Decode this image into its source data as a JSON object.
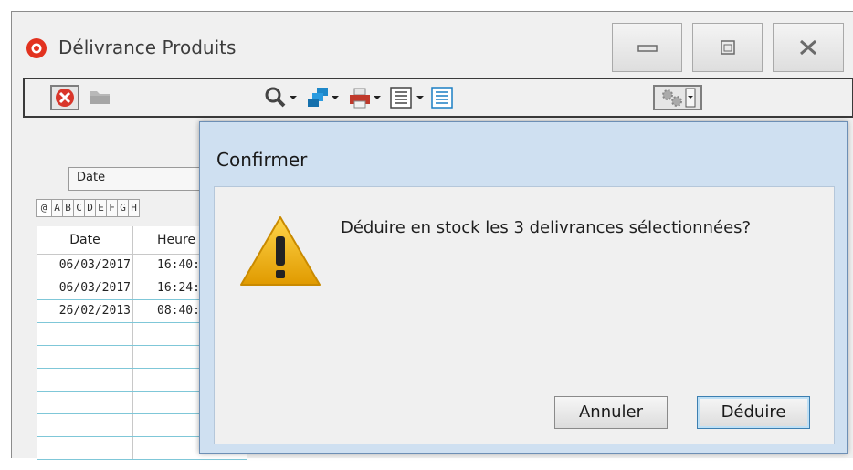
{
  "window": {
    "title": "Délivrance Produits"
  },
  "toolbar": {
    "icons": [
      "close-circle-icon",
      "folder-icon",
      "search-icon",
      "copy-icon",
      "print-icon",
      "list-icon",
      "list-icon",
      "gears-icon"
    ]
  },
  "filter": {
    "selected": "Date"
  },
  "alphabet_tabs": [
    "@",
    "A",
    "B",
    "C",
    "D",
    "E",
    "F",
    "G",
    "H"
  ],
  "table": {
    "columns": [
      "Date",
      "Heure"
    ],
    "rows": [
      {
        "date": "06/03/2017",
        "heure": "16:40:"
      },
      {
        "date": "06/03/2017",
        "heure": "16:24:"
      },
      {
        "date": "26/02/2013",
        "heure": "08:40:"
      }
    ]
  },
  "dialog": {
    "title": "Confirmer",
    "message": "Déduire en stock les 3 delivrances sélectionnées?",
    "cancel_label": "Annuler",
    "confirm_label": "Déduire"
  },
  "colors": {
    "dialog_frame": "#cfe0f1",
    "grid_line": "#7fc7d8",
    "warning": "#f0b400"
  }
}
